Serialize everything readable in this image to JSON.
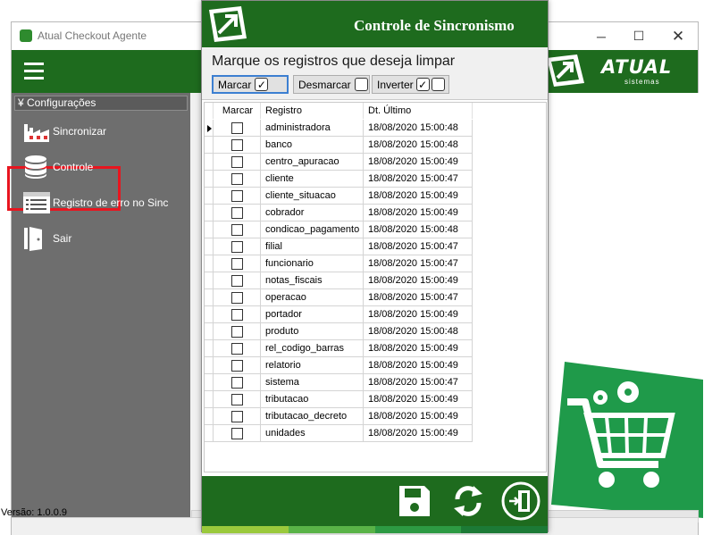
{
  "main_window": {
    "title": "Atual Checkout Agente",
    "minimize_glyph": "─",
    "maximize_glyph": "☐",
    "close_glyph": "✕",
    "version": "Versão: 1.0.0.9"
  },
  "brand": {
    "name": "ATUAL",
    "subtitle": "sistemas"
  },
  "sidebar": {
    "group_label": "Configurações",
    "group_icon": "double-chevron-down-icon",
    "items": [
      {
        "label": "Sincronizar",
        "icon": "factory-icon"
      },
      {
        "label": "Controle",
        "icon": "database-icon"
      },
      {
        "label": "Registro de erro no Sinc",
        "icon": "log-list-icon"
      },
      {
        "label": "Sair",
        "icon": "door-exit-icon"
      }
    ]
  },
  "dialog": {
    "title": "Controle de Sincronismo",
    "instruction": "Marque os registros que deseja limpar",
    "buttons": {
      "marcar": "Marcar",
      "desmarcar": "Desmarcar",
      "inverter": "Inverter"
    },
    "grid": {
      "columns": [
        "Marcar",
        "Registro",
        "Dt. Último"
      ],
      "rows": [
        {
          "registro": "administradora",
          "dt": "18/08/2020 15:00:48",
          "checked": false
        },
        {
          "registro": "banco",
          "dt": "18/08/2020 15:00:48",
          "checked": false
        },
        {
          "registro": "centro_apuracao",
          "dt": "18/08/2020 15:00:49",
          "checked": false
        },
        {
          "registro": "cliente",
          "dt": "18/08/2020 15:00:47",
          "checked": false
        },
        {
          "registro": "cliente_situacao",
          "dt": "18/08/2020 15:00:49",
          "checked": false
        },
        {
          "registro": "cobrador",
          "dt": "18/08/2020 15:00:49",
          "checked": false
        },
        {
          "registro": "condicao_pagamento",
          "dt": "18/08/2020 15:00:48",
          "checked": false
        },
        {
          "registro": "filial",
          "dt": "18/08/2020 15:00:47",
          "checked": false
        },
        {
          "registro": "funcionario",
          "dt": "18/08/2020 15:00:47",
          "checked": false
        },
        {
          "registro": "notas_fiscais",
          "dt": "18/08/2020 15:00:49",
          "checked": false
        },
        {
          "registro": "operacao",
          "dt": "18/08/2020 15:00:47",
          "checked": false
        },
        {
          "registro": "portador",
          "dt": "18/08/2020 15:00:49",
          "checked": false
        },
        {
          "registro": "produto",
          "dt": "18/08/2020 15:00:48",
          "checked": false
        },
        {
          "registro": "rel_codigo_barras",
          "dt": "18/08/2020 15:00:49",
          "checked": false
        },
        {
          "registro": "relatorio",
          "dt": "18/08/2020 15:00:49",
          "checked": false
        },
        {
          "registro": "sistema",
          "dt": "18/08/2020 15:00:47",
          "checked": false
        },
        {
          "registro": "tributacao",
          "dt": "18/08/2020 15:00:49",
          "checked": false
        },
        {
          "registro": "tributacao_decreto",
          "dt": "18/08/2020 15:00:49",
          "checked": false
        },
        {
          "registro": "unidades",
          "dt": "18/08/2020 15:00:49",
          "checked": false
        }
      ]
    },
    "footer_icons": [
      "save-icon",
      "refresh-icon",
      "exit-icon"
    ]
  },
  "colors": {
    "brand_green": "#1e6b1e",
    "cart_green": "#1f9a4a",
    "sidebar_gray": "#6e6e6e",
    "highlight_red": "#e8151f",
    "stripe": [
      "#9ac93c",
      "#59b347",
      "#2d9a43",
      "#1c7a36"
    ]
  }
}
